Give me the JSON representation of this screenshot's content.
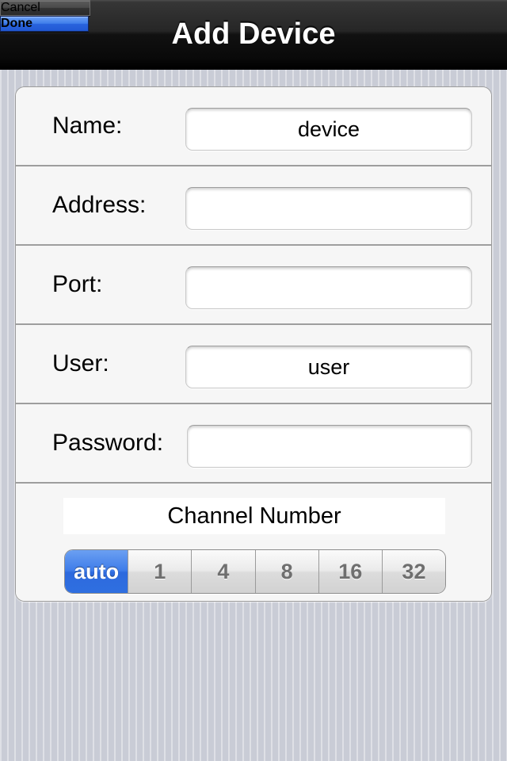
{
  "navbar": {
    "title": "Add Device",
    "cancel_label": "Cancel",
    "done_label": "Done",
    "accent_color": "#2f6fe0",
    "background_color": "#111111"
  },
  "form": {
    "rows": [
      {
        "label": "Name:",
        "value": "device",
        "placeholder": "",
        "secure": false
      },
      {
        "label": "Address:",
        "value": "",
        "placeholder": "",
        "secure": false
      },
      {
        "label": "Port:",
        "value": "",
        "placeholder": "",
        "secure": false
      },
      {
        "label": "User:",
        "value": "user",
        "placeholder": "",
        "secure": false
      },
      {
        "label": "Password:",
        "value": "",
        "placeholder": "",
        "secure": true
      }
    ]
  },
  "channel": {
    "title": "Channel Number",
    "selected": "auto",
    "options": [
      "auto",
      "1",
      "4",
      "8",
      "16",
      "32"
    ]
  }
}
